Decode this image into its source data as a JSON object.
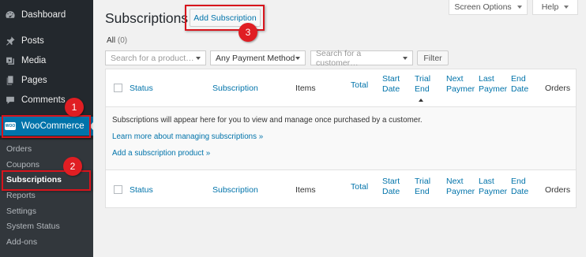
{
  "sidebar": {
    "items": [
      {
        "label": "Dashboard",
        "icon": "dashboard-icon"
      },
      {
        "label": "Posts",
        "icon": "pin-icon"
      },
      {
        "label": "Media",
        "icon": "media-icon"
      },
      {
        "label": "Pages",
        "icon": "pages-icon"
      },
      {
        "label": "Comments",
        "icon": "comments-icon"
      }
    ],
    "woocommerce": {
      "label": "WooCommerce",
      "icon": "woocommerce-icon",
      "badge": "WOO"
    },
    "submenu": [
      "Orders",
      "Coupons",
      "Subscriptions",
      "Reports",
      "Settings",
      "System Status",
      "Add-ons"
    ],
    "current_submenu": "Subscriptions"
  },
  "header": {
    "title": "Subscriptions",
    "add_button": "Add Subscription",
    "screen_options": "Screen Options",
    "help": "Help"
  },
  "views": {
    "all_label": "All",
    "all_count": "(0)"
  },
  "filters": {
    "product_placeholder": "Search for a product…",
    "payment_method": "Any Payment Method",
    "customer_placeholder": "Search for a customer…",
    "filter_button": "Filter"
  },
  "table": {
    "columns": {
      "status": "Status",
      "subscription": "Subscription",
      "items": "Items",
      "total": "Total",
      "start_date": [
        "Start",
        "Date"
      ],
      "trial_end": [
        "Trial",
        "End"
      ],
      "next_payment": [
        "Next",
        "Paymer"
      ],
      "last_payment": [
        "Last",
        "Paymer"
      ],
      "end_date": [
        "End",
        "Date"
      ],
      "orders": "Orders"
    },
    "empty_message": "Subscriptions will appear here for you to view and manage once purchased by a customer.",
    "learn_more": "Learn more about managing subscriptions »",
    "add_product": "Add a subscription product »"
  },
  "callouts": [
    "1",
    "2",
    "3"
  ],
  "colors": {
    "sidebar": "#23282d",
    "submenu": "#32373c",
    "accent": "#0073aa",
    "callout": "#e01e23"
  }
}
